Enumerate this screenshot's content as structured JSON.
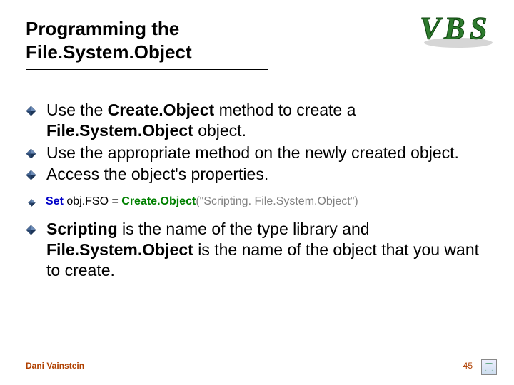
{
  "title_line1": "Programming the",
  "title_line2": "File.System.Object",
  "logo": {
    "letters": [
      "V",
      "B",
      "S"
    ]
  },
  "bullets": [
    {
      "level": 1,
      "parts": [
        {
          "t": "Use the "
        },
        {
          "t": "Create.Object",
          "bold": true
        },
        {
          "t": " method to create a "
        },
        {
          "t": "File.System.Object",
          "bold": true
        },
        {
          "t": " object."
        }
      ]
    },
    {
      "level": 1,
      "parts": [
        {
          "t": "Use the appropriate method on the newly created object."
        }
      ]
    },
    {
      "level": 1,
      "parts": [
        {
          "t": "Access the object's properties."
        }
      ]
    },
    {
      "level": 2,
      "code": true,
      "parts": [
        {
          "t": "Set ",
          "cls": "code-kw"
        },
        {
          "t": "obj.FSO = ",
          "cls": "code-name"
        },
        {
          "t": "Create.Object",
          "cls": "code-fn"
        },
        {
          "t": "(\"Scripting. File.System.Object\")",
          "cls": "code-str"
        }
      ]
    },
    {
      "level": 1,
      "parts": [
        {
          "t": "Scripting",
          "bold": true
        },
        {
          "t": " is the name of the type library and "
        },
        {
          "t": "File.System.Object",
          "bold": true
        },
        {
          "t": " is the name of the object that you want to create."
        }
      ]
    }
  ],
  "footer": {
    "author": "Dani Vainstein",
    "page": "45"
  }
}
